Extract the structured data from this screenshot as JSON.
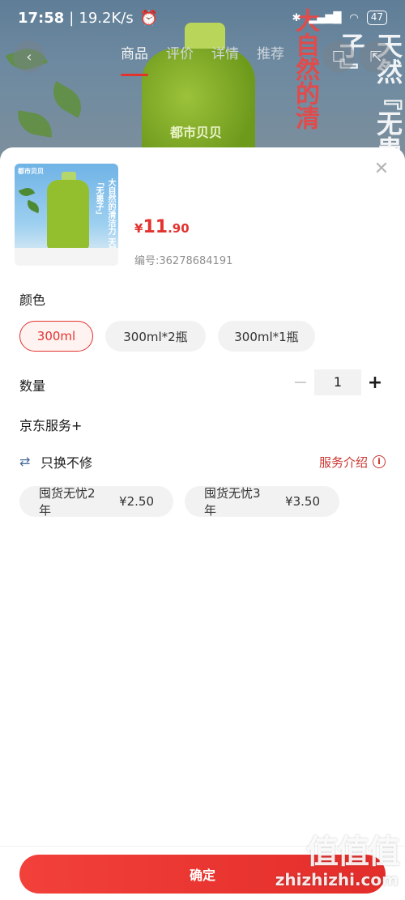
{
  "status_bar": {
    "time": "17:58",
    "speed": "19.2K/s",
    "battery": "47"
  },
  "background_nav": {
    "tabs": [
      {
        "label": "商品",
        "active": true
      },
      {
        "label": "评价",
        "active": false
      },
      {
        "label": "详情",
        "active": false
      },
      {
        "label": "推荐",
        "active": false
      }
    ],
    "tagline_red": "大自然的清",
    "tagline_white": "天然『无患子』",
    "brand": "都市贝贝"
  },
  "product": {
    "price_symbol": "¥",
    "price_integer": "11",
    "price_decimal": ".90",
    "sku_number": "编号:36278684191",
    "thumb_text": "大自然的清洁力 天然「无患子」",
    "thumb_logo": "都市贝贝"
  },
  "color_section": {
    "label": "颜色",
    "options": [
      {
        "label": "300ml",
        "selected": true
      },
      {
        "label": "300ml*2瓶",
        "selected": false
      },
      {
        "label": "300ml*1瓶",
        "selected": false
      }
    ]
  },
  "quantity_section": {
    "label": "数量",
    "value": "1",
    "minus": "−",
    "plus": "+"
  },
  "service_section": {
    "label": "京东服务+",
    "item_name": "只换不修",
    "intro_label": "服务介绍",
    "options": [
      {
        "name": "囤货无忧2年",
        "price": "¥2.50"
      },
      {
        "name": "囤货无忧3年",
        "price": "¥3.50"
      }
    ]
  },
  "footer": {
    "confirm_label": "确定"
  },
  "watermark": {
    "glyphs": "值值值",
    "site": "zhizhizhi.com"
  },
  "colors": {
    "accent": "#e3332f",
    "service_link": "#c9342f"
  }
}
